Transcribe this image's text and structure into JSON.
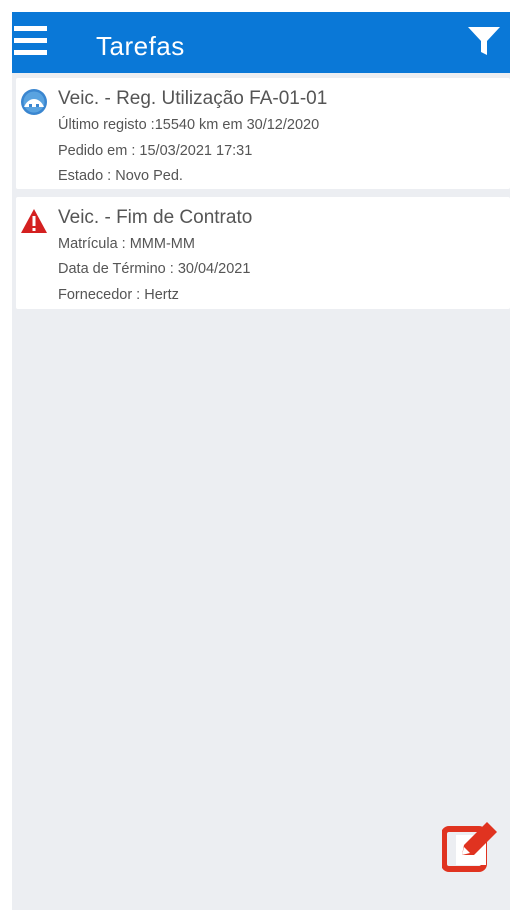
{
  "header": {
    "title": "Tarefas",
    "bg_color": "#0a78d7",
    "menu_icon": "hamburger-menu-icon",
    "filter_icon": "filter-funnel-icon"
  },
  "tasks": [
    {
      "icon": "vehicle-usage-icon",
      "title": "Veic. - Reg. Utilização FA-01-01",
      "lines": [
        "Último registo :15540 km em 30/12/2020",
        "Pedido em : 15/03/2021 17:31",
        "Estado : Novo Ped."
      ]
    },
    {
      "icon": "warning-triangle-icon",
      "title": "Veic. - Fim de Contrato",
      "lines": [
        "Matrícula : MMM-MM",
        "Data de Término : 30/04/2021",
        "Fornecedor : Hertz"
      ]
    }
  ],
  "fab": {
    "icon": "edit-icon",
    "color": "#e03320"
  },
  "colors": {
    "warning": "#d42020",
    "background": "#eceef2"
  }
}
